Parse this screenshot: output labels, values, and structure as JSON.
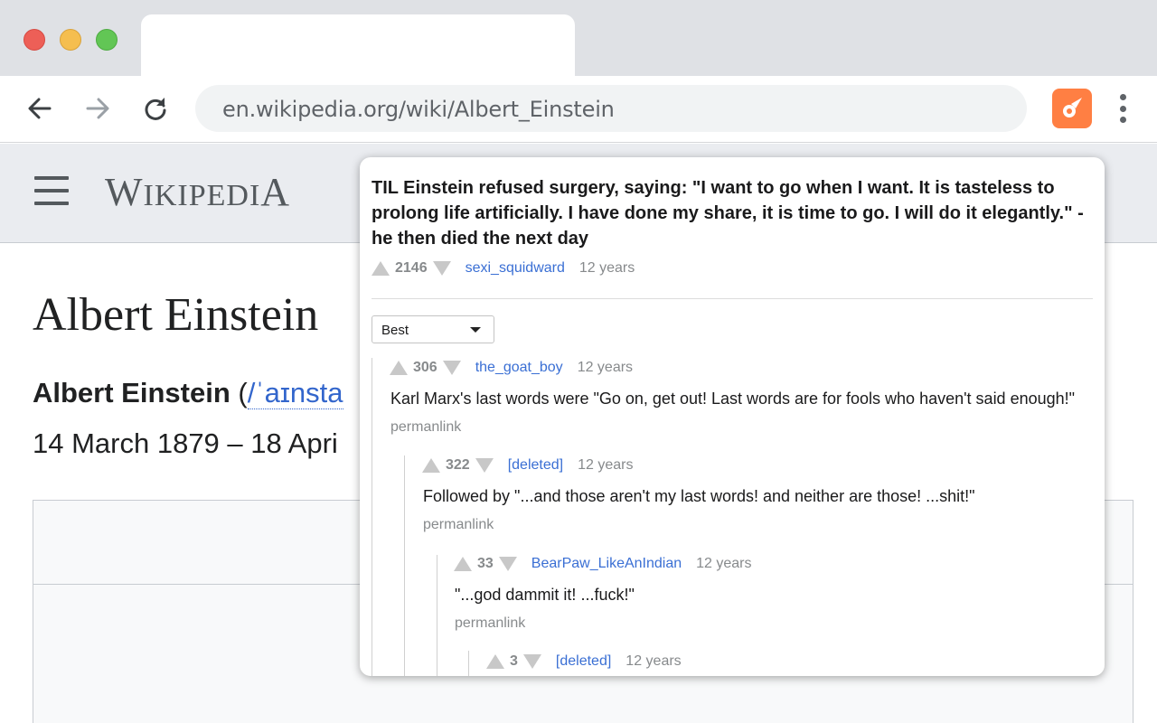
{
  "browser": {
    "url": "en.wikipedia.org/wiki/Albert_Einstein",
    "extension_icon": "comet-icon",
    "colors": {
      "extension_bg": "#ff7f43",
      "tabstrip": "#dfe1e5"
    }
  },
  "wikipedia": {
    "logo_first": "W",
    "logo_mid": "IKIPEDI",
    "logo_last": "A",
    "article_title": "Albert Einstein",
    "lead_name": "Albert Einstein",
    "lead_paren": " (",
    "lead_ipa": "/ˈaɪnsta",
    "dates": "14 March 1879 – 18 Apri"
  },
  "popup": {
    "post": {
      "title": "TIL Einstein refused surgery, saying: \"I want to go when I want. It is tasteless to prolong life artificially. I have done my share, it is time to go. I will do it elegantly.\" - he then died the next day",
      "score": "2146",
      "author": "sexi_squidward",
      "age": "12 years"
    },
    "sort": {
      "selected": "Best"
    },
    "comments": [
      {
        "score": "306",
        "author": "the_goat_boy",
        "age": "12 years",
        "body": "Karl Marx's last words were \"Go on, get out! Last words are for fools who haven't said enough!\"",
        "permalink": "permanlink"
      },
      {
        "score": "322",
        "author": "[deleted]",
        "age": "12 years",
        "body": "Followed by \"...and those aren't my last words! and neither are those! ...shit!\"",
        "permalink": "permanlink"
      },
      {
        "score": "33",
        "author": "BearPaw_LikeAnIndian",
        "age": "12 years",
        "body": "\"...god dammit it! ...fuck!\"",
        "permalink": "permanlink"
      },
      {
        "score": "3",
        "author": "[deleted]",
        "age": "12 years"
      }
    ]
  }
}
